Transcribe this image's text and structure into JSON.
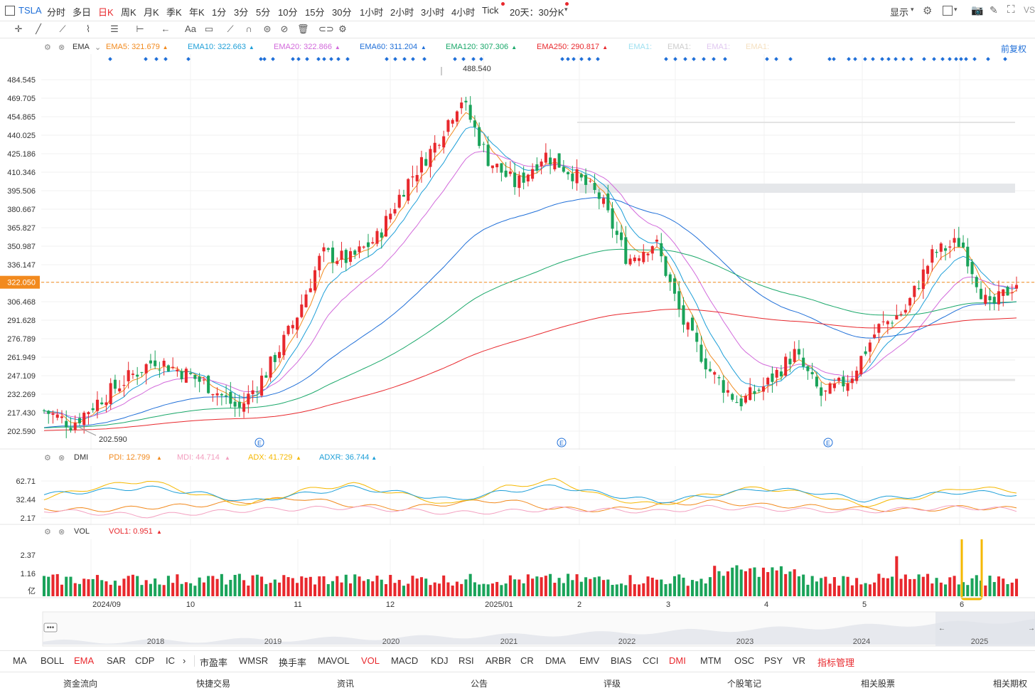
{
  "toolbar": {
    "symbol": "TSLA",
    "periods": [
      "分时",
      "多日",
      "日K",
      "周K",
      "月K",
      "季K",
      "年K",
      "1分",
      "3分",
      "5分",
      "10分",
      "15分",
      "30分",
      "1小时",
      "2小时",
      "3小时",
      "4小时",
      "Tick"
    ],
    "active_period": "日K",
    "range_label": "20天：30分K",
    "display_label": "显示"
  },
  "main_indicator": {
    "name": "EMA",
    "items": [
      {
        "label": "EMA5:",
        "value": "321.679",
        "color": "#f28a1e"
      },
      {
        "label": "EMA10:",
        "value": "322.663",
        "color": "#1e9fd8"
      },
      {
        "label": "EMA20:",
        "value": "322.866",
        "color": "#d26adb"
      },
      {
        "label": "EMA60:",
        "value": "311.204",
        "color": "#1f6fd8"
      },
      {
        "label": "EMA120:",
        "value": "307.306",
        "color": "#1aa86a"
      },
      {
        "label": "EMA250:",
        "value": "290.817",
        "color": "#e8282d"
      }
    ],
    "faded": [
      "EMA1:",
      "EMA1:",
      "EMA1:",
      "EMA1:"
    ],
    "rights_label": "前复权",
    "y_ticks": [
      "484.545",
      "469.705",
      "454.865",
      "440.025",
      "425.186",
      "410.346",
      "395.506",
      "380.667",
      "365.827",
      "350.987",
      "336.147",
      "322.050",
      "306.468",
      "291.628",
      "276.789",
      "261.949",
      "247.109",
      "232.269",
      "217.430",
      "202.590"
    ],
    "current_price": "322.050",
    "high_label": "488.540",
    "low_label": "202.590",
    "event_marker": "E"
  },
  "dmi": {
    "name": "DMI",
    "items": [
      {
        "label": "PDI:",
        "value": "12.799",
        "color": "#f28a1e"
      },
      {
        "label": "MDI:",
        "value": "44.714",
        "color": "#f3a0c0"
      },
      {
        "label": "ADX:",
        "value": "41.729",
        "color": "#f5b800"
      },
      {
        "label": "ADXR:",
        "value": "36.744",
        "color": "#1e9fd8"
      }
    ],
    "y_ticks": [
      "62.71",
      "32.44",
      "2.17"
    ]
  },
  "vol": {
    "name": "VOL",
    "items": [
      {
        "label": "VOL1:",
        "value": "0.951",
        "color": "#e8282d"
      }
    ],
    "y_ticks": [
      "2.37",
      "1.16",
      "亿"
    ]
  },
  "x_axis": [
    "2024/09",
    "10",
    "11",
    "12",
    "2025/01",
    "2",
    "3",
    "4",
    "5",
    "6"
  ],
  "navigator_years": [
    "2018",
    "2019",
    "2020",
    "2021",
    "2022",
    "2023",
    "2024",
    "2025"
  ],
  "indicator_tabs": [
    "MA",
    "BOLL",
    "EMA",
    "SAR",
    "CDP",
    "IC",
    "市盈率",
    "WMSR",
    "换手率",
    "MAVOL",
    "VOL",
    "MACD",
    "KDJ",
    "RSI",
    "ARBR",
    "CR",
    "DMA",
    "EMV",
    "BIAS",
    "CCI",
    "DMI",
    "MTM",
    "OSC",
    "PSY",
    "VR",
    "指标管理"
  ],
  "highlighted_tabs": [
    "EMA",
    "VOL",
    "DMI",
    "指标管理"
  ],
  "bottom_nav": [
    "资金流向",
    "快捷交易",
    "资讯",
    "公告",
    "评级",
    "个股笔记",
    "相关股票",
    "相关期权"
  ],
  "colors": {
    "up": "#e8282d",
    "down": "#1aa35a",
    "accent": "#e8282d",
    "blue": "#1f6fd8"
  },
  "chart_data": {
    "type": "candlestick",
    "price_range": [
      202.59,
      488.54
    ],
    "y_ticks": [
      484.545,
      469.705,
      454.865,
      440.025,
      425.186,
      410.346,
      395.506,
      380.667,
      365.827,
      350.987,
      336.147,
      322.05,
      306.468,
      291.628,
      276.789,
      261.949,
      247.109,
      232.269,
      217.43,
      202.59
    ],
    "series_close_path": [
      {
        "x": "2024/09",
        "y": 219
      },
      {
        "x": "2024/09",
        "y": 208
      },
      {
        "x": "2024/09",
        "y": 228
      },
      {
        "x": "2024/09",
        "y": 245
      },
      {
        "x": "10",
        "y": 260
      },
      {
        "x": "10",
        "y": 250
      },
      {
        "x": "10",
        "y": 238
      },
      {
        "x": "10",
        "y": 220
      },
      {
        "x": "11",
        "y": 250
      },
      {
        "x": "11",
        "y": 290
      },
      {
        "x": "11",
        "y": 345
      },
      {
        "x": "11",
        "y": 340
      },
      {
        "x": "12",
        "y": 358
      },
      {
        "x": "12",
        "y": 400
      },
      {
        "x": "12",
        "y": 430
      },
      {
        "x": "12",
        "y": 470
      },
      {
        "x": "2025/01",
        "y": 420
      },
      {
        "x": "2025/01",
        "y": 400
      },
      {
        "x": "2025/01",
        "y": 425
      },
      {
        "x": "2025/01",
        "y": 410
      },
      {
        "x": "2",
        "y": 390
      },
      {
        "x": "2",
        "y": 340
      },
      {
        "x": "2",
        "y": 355
      },
      {
        "x": "3",
        "y": 290
      },
      {
        "x": "3",
        "y": 250
      },
      {
        "x": "3",
        "y": 225
      },
      {
        "x": "3",
        "y": 240
      },
      {
        "x": "4",
        "y": 265
      },
      {
        "x": "4",
        "y": 230
      },
      {
        "x": "4",
        "y": 245
      },
      {
        "x": "5",
        "y": 285
      },
      {
        "x": "5",
        "y": 300
      },
      {
        "x": "5",
        "y": 345
      },
      {
        "x": "6",
        "y": 355
      },
      {
        "x": "6",
        "y": 300
      },
      {
        "x": "6",
        "y": 322
      }
    ],
    "ema_last": {
      "EMA5": 321.679,
      "EMA10": 322.663,
      "EMA20": 322.866,
      "EMA60": 311.204,
      "EMA120": 307.306,
      "EMA250": 290.817
    },
    "dmi_last": {
      "PDI": 12.799,
      "MDI": 44.714,
      "ADX": 41.729,
      "ADXR": 36.744
    },
    "vol_last": 0.951,
    "vol_range": [
      0,
      2.37
    ]
  }
}
